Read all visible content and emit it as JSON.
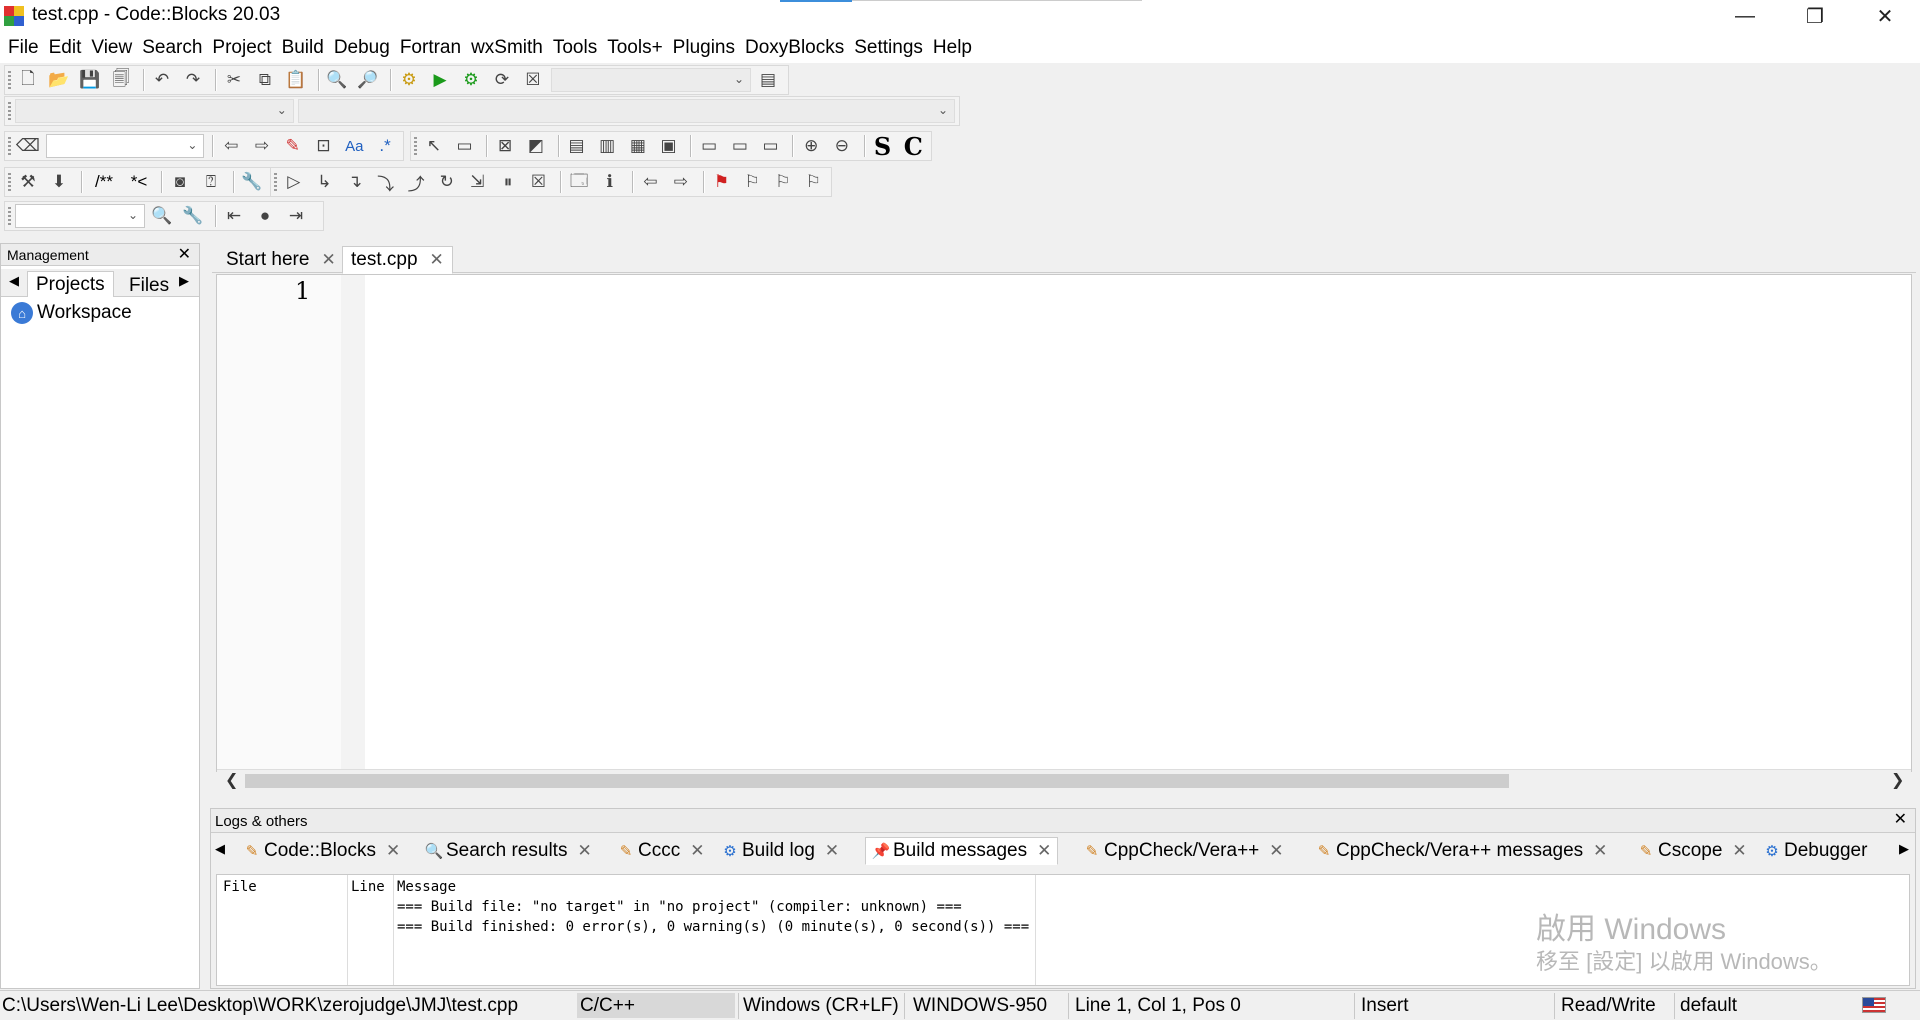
{
  "window": {
    "title": "test.cpp - Code::Blocks 20.03",
    "minimize": "—",
    "restore": "❐",
    "close": "✕"
  },
  "menu": [
    "File",
    "Edit",
    "View",
    "Search",
    "Project",
    "Build",
    "Debug",
    "Fortran",
    "wxSmith",
    "Tools",
    "Tools+",
    "Plugins",
    "DoxyBlocks",
    "Settings",
    "Help"
  ],
  "toolbars": {
    "doxy_comment": "/**",
    "doxy_inline": "*<",
    "s_label": "S",
    "c_label": "C",
    "regex_label": ".*",
    "aa_label": "Aa"
  },
  "management": {
    "title": "Management",
    "tabs": [
      "Projects",
      "Files"
    ],
    "workspace": "Workspace"
  },
  "editor": {
    "tabs": [
      "Start here",
      "test.cpp"
    ],
    "active_tab": "test.cpp",
    "line_number": "1"
  },
  "logs": {
    "title": "Logs & others",
    "tabs": [
      "Code::Blocks",
      "Search results",
      "Cccc",
      "Build log",
      "Build messages",
      "CppCheck/Vera++",
      "CppCheck/Vera++ messages",
      "Cscope",
      "Debugger"
    ],
    "active_tab": "Build messages",
    "columns": [
      "File",
      "Line",
      "Message"
    ],
    "messages": [
      "=== Build file: \"no target\" in \"no project\" (compiler: unknown) ===",
      "=== Build finished: 0 error(s), 0 warning(s) (0 minute(s), 0 second(s)) ==="
    ]
  },
  "watermark": {
    "line1": "啟用 Windows",
    "line2": "移至 [設定] 以啟用 Windows。"
  },
  "status": {
    "path": "C:\\Users\\Wen-Li Lee\\Desktop\\WORK\\zerojudge\\JMJ\\test.cpp",
    "language": "C/C++",
    "line_endings": "Windows (CR+LF)",
    "encoding": "WINDOWS-950",
    "position": "Line 1, Col 1, Pos 0",
    "mode": "Insert",
    "access": "Read/Write",
    "profile": "default"
  }
}
